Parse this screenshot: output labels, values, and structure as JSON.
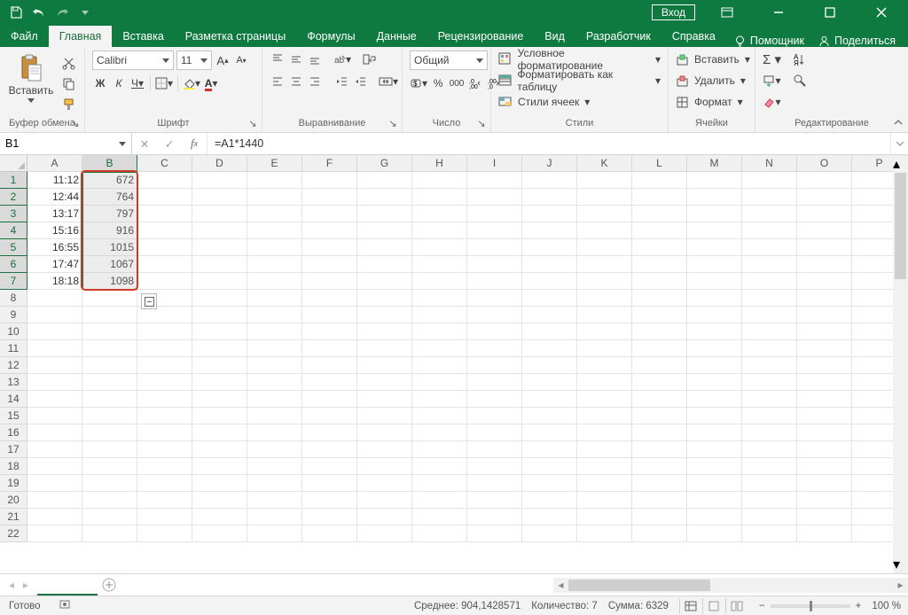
{
  "titlebar": {
    "login": "Вход"
  },
  "tabs": {
    "items": [
      "Файл",
      "Главная",
      "Вставка",
      "Разметка страницы",
      "Формулы",
      "Данные",
      "Рецензирование",
      "Вид",
      "Разработчик",
      "Справка"
    ],
    "active_index": 1,
    "tell_me": "Помощник",
    "share": "Поделиться"
  },
  "ribbon": {
    "clipboard": {
      "paste": "Вставить",
      "label": "Буфер обмена"
    },
    "font": {
      "name": "Calibri",
      "size": "11",
      "bold": "Ж",
      "italic": "К",
      "underline": "Ч",
      "label": "Шрифт"
    },
    "align": {
      "label": "Выравнивание"
    },
    "number": {
      "format": "Общий",
      "label": "Число"
    },
    "styles": {
      "cond": "Условное форматирование",
      "table": "Форматировать как таблицу",
      "cell": "Стили ячеек",
      "label": "Стили"
    },
    "cells": {
      "insert": "Вставить",
      "delete": "Удалить",
      "format": "Формат",
      "label": "Ячейки"
    },
    "editing": {
      "label": "Редактирование"
    }
  },
  "namebox": "B1",
  "formula": "=A1*1440",
  "columns": [
    "A",
    "B",
    "C",
    "D",
    "E",
    "F",
    "G",
    "H",
    "I",
    "J",
    "K",
    "L",
    "M",
    "N",
    "O",
    "P"
  ],
  "rows": 22,
  "data": {
    "A": [
      "11:12",
      "12:44",
      "13:17",
      "15:16",
      "16:55",
      "17:47",
      "18:18"
    ],
    "B": [
      "672",
      "764",
      "797",
      "916",
      "1015",
      "1067",
      "1098"
    ]
  },
  "selection": {
    "col_index": 1,
    "row_start": 1,
    "row_end": 7
  },
  "sheet": {
    "active": " "
  },
  "status": {
    "ready": "Готово",
    "avg_label": "Среднее:",
    "avg": "904,1428571",
    "count_label": "Количество:",
    "count": "7",
    "sum_label": "Сумма:",
    "sum": "6329",
    "zoom": "100 %"
  }
}
